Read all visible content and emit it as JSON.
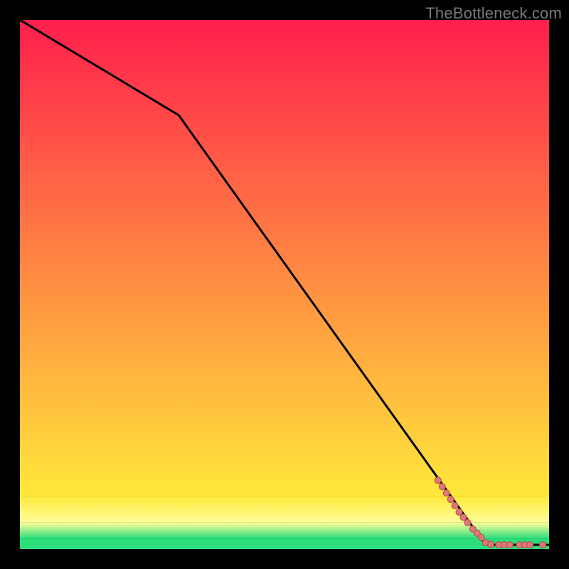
{
  "attribution": "TheBottleneck.com",
  "colors": {
    "markers_fill": "#d97a78",
    "markers_stroke": "#b94a48",
    "line": "#000000",
    "bg_black": "#000000",
    "grad_top": "#ff1f4c",
    "grad_orange": "#ff8a2a",
    "grad_yellow": "#ffe83a",
    "grad_paleyellow": "#ffff9a",
    "grad_green": "#2ade7c"
  },
  "chart_data": {
    "type": "line",
    "title": "",
    "xlabel": "",
    "ylabel": "",
    "xlim": [
      0,
      100
    ],
    "ylim": [
      0,
      100
    ],
    "gradient_bands": [
      {
        "y_top": 100,
        "y_bot": 10,
        "from": "#ff1f4c",
        "to": "#ffe83a"
      },
      {
        "y_top": 10,
        "y_bot": 5,
        "from": "#ffe83a",
        "to": "#ffff9a"
      },
      {
        "y_top": 5,
        "y_bot": 2,
        "from": "#ffff9a",
        "to": "#2ade7c"
      },
      {
        "y_top": 2,
        "y_bot": 0,
        "from": "#2ade7c",
        "to": "#2ade7c"
      }
    ],
    "series": [
      {
        "name": "curve",
        "kind": "line",
        "x": [
          0,
          30,
          88,
          100
        ],
        "y": [
          100,
          82,
          0.8,
          0.8
        ]
      },
      {
        "name": "markers",
        "kind": "scatter",
        "points": [
          {
            "x": 79.0,
            "y": 13.0,
            "r": 4.5
          },
          {
            "x": 79.8,
            "y": 11.8,
            "r": 4.5
          },
          {
            "x": 80.6,
            "y": 10.6,
            "r": 4.5
          },
          {
            "x": 81.4,
            "y": 9.4,
            "r": 4.5
          },
          {
            "x": 82.2,
            "y": 8.2,
            "r": 4.5
          },
          {
            "x": 83.0,
            "y": 7.0,
            "r": 4.5
          },
          {
            "x": 83.8,
            "y": 6.0,
            "r": 4.5
          },
          {
            "x": 84.6,
            "y": 5.0,
            "r": 4.5
          },
          {
            "x": 85.6,
            "y": 3.8,
            "r": 4.5
          },
          {
            "x": 86.4,
            "y": 3.0,
            "r": 4.5
          },
          {
            "x": 87.2,
            "y": 2.2,
            "r": 4.5
          },
          {
            "x": 88.0,
            "y": 1.2,
            "r": 4.5
          },
          {
            "x": 89.0,
            "y": 0.9,
            "r": 4.5
          },
          {
            "x": 90.5,
            "y": 0.8,
            "r": 4.5
          },
          {
            "x": 91.5,
            "y": 0.8,
            "r": 4.5
          },
          {
            "x": 92.6,
            "y": 0.8,
            "r": 4.5
          },
          {
            "x": 94.4,
            "y": 0.8,
            "r": 4.5
          },
          {
            "x": 95.4,
            "y": 0.8,
            "r": 4.5
          },
          {
            "x": 96.4,
            "y": 0.8,
            "r": 4.5
          },
          {
            "x": 98.8,
            "y": 0.8,
            "r": 4.5
          }
        ]
      }
    ]
  }
}
